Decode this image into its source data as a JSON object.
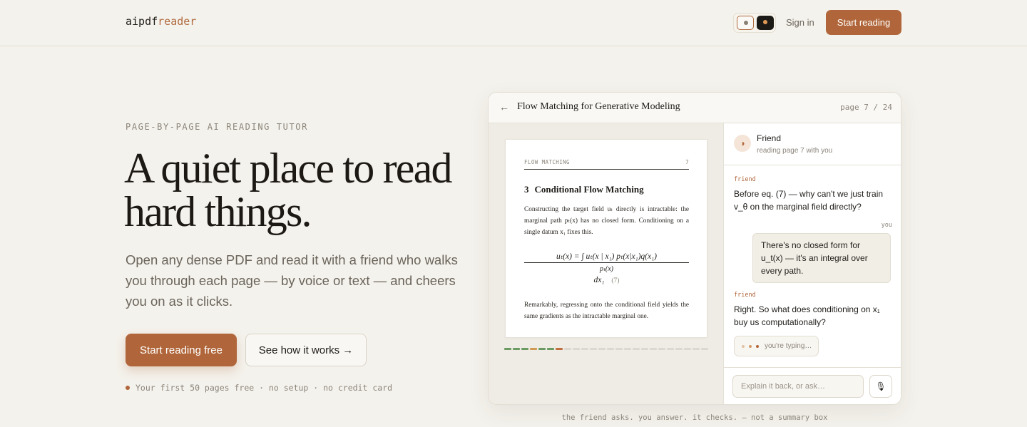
{
  "header": {
    "logo_part1": "aipdf",
    "logo_part2": "reader",
    "signin_label": "Sign in",
    "cta_label": "Start reading"
  },
  "hero": {
    "eyebrow": "PAGE-BY-PAGE AI READING TUTOR",
    "headline_line1": "A quiet place to read",
    "headline_line2": "hard things.",
    "subtext": "Open any dense PDF and read it with a friend who walks you through each page — by voice or text — and cheers you on as it clicks.",
    "primary_cta": "Start reading free",
    "secondary_cta": "See how it works →",
    "note": "Your first 50 pages free · no setup · no credit card"
  },
  "mockup": {
    "back_icon": "←",
    "doc_title": "Flow Matching for Generative Modeling",
    "page_indicator": "page 7 / 24",
    "paper": {
      "running_head": "FLOW MATCHING",
      "page_num": "7",
      "section_num": "3",
      "section_title": "Conditional Flow Matching",
      "para1": "Constructing the target field uₜ directly is intractable: the marginal path pₜ(x) has no closed form. Conditioning on a single datum x₁ fixes this.",
      "eq_numerator": "uₜ(x) = ∫ uₜ(x | x₁) pₜ(x|x₁)q(x₁)",
      "eq_denominator": "pₜ(x)",
      "eq_dx": "dx₁",
      "eq_tag": "(7)",
      "para2": "Remarkably, regressing onto the conditional field yields the same gradients as the intractable marginal one."
    },
    "progress": {
      "total": 24,
      "pages": [
        "read",
        "read",
        "read",
        "flag",
        "read",
        "read",
        "current",
        "u",
        "u",
        "u",
        "u",
        "u",
        "u",
        "u",
        "u",
        "u",
        "u",
        "u",
        "u",
        "u",
        "u",
        "u",
        "u",
        "u"
      ],
      "colors": {
        "read": "#6b9a62",
        "flag": "#d19a52",
        "current": "#c07040",
        "u": "#dcd8cf"
      }
    },
    "chat": {
      "avatar_icon": "◑",
      "name": "Friend",
      "status": "reading page 7 with you",
      "friend_label": "friend",
      "you_label": "you",
      "msg1": "Before eq. (7) — why can't we just train v_θ on the marginal field directly?",
      "msg2": "There's no closed form for u_t(x) — it's an integral over every path.",
      "msg3": "Right. So what does conditioning on x₁ buy us computationally?",
      "typing": "you're typing…",
      "typing_dot_colors": [
        "#e3c3a5",
        "#d49a6e",
        "#b0663a"
      ],
      "input_placeholder": "Explain it back, or ask…",
      "mic_icon": "🎙"
    }
  },
  "caption": "the friend asks. you answer. it checks. — not a summary box",
  "colors": {
    "accent": "#b0663a",
    "background": "#f4f2ec"
  }
}
